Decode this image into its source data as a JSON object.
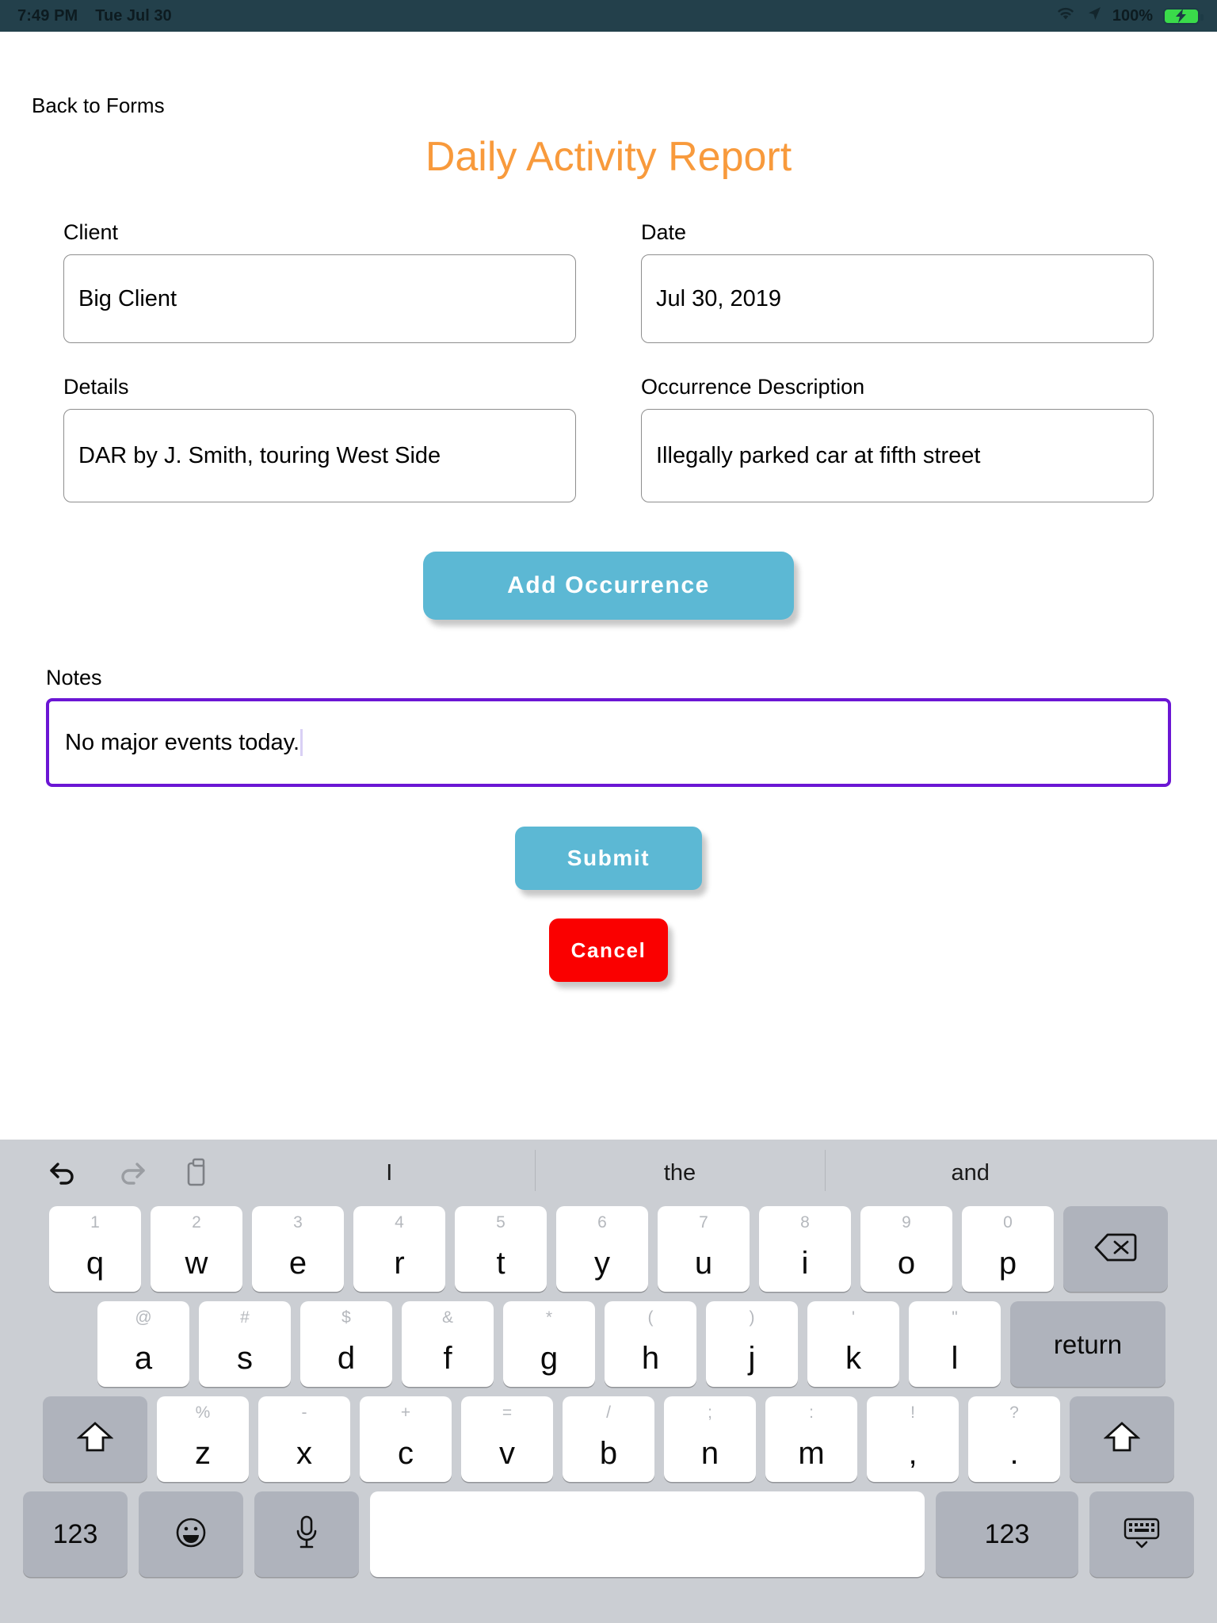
{
  "status_bar": {
    "time": "7:49 PM",
    "date": "Tue Jul 30",
    "battery_percent": "100%",
    "wifi_icon": "wifi-icon",
    "location_icon": "location-arrow-icon",
    "battery_icon": "battery-charging-icon",
    "background_color": "#23404B",
    "battery_fill_color": "#3ADB4A"
  },
  "nav": {
    "back_label": "Back to Forms"
  },
  "page": {
    "title": "Daily Activity Report",
    "title_color": "#F89A3C"
  },
  "form": {
    "fields": [
      {
        "label": "Client",
        "value": "Big Client"
      },
      {
        "label": "Date",
        "value": "Jul 30, 2019"
      },
      {
        "label": "Details",
        "value": "DAR by J. Smith, touring West Side"
      },
      {
        "label": "Occurrence Description",
        "value": "Illegally parked car at fifth street"
      }
    ],
    "notes": {
      "label": "Notes",
      "value": "No major events today.",
      "focus_border_color": "#6B16D4"
    }
  },
  "buttons": {
    "add_occurrence": {
      "label": "Add Occurrence",
      "color": "#5CB8D4"
    },
    "submit": {
      "label": "Submit",
      "color": "#5CB8D4"
    },
    "cancel": {
      "label": "Cancel",
      "color": "#FA0000"
    }
  },
  "keyboard": {
    "background_color": "#CBCED3",
    "toolbar": {
      "undo_icon": "undo-icon",
      "redo_icon": "redo-icon",
      "paste_icon": "paste-icon"
    },
    "suggestions": [
      "I",
      "the",
      "and"
    ],
    "row1": [
      {
        "main": "q",
        "sub": "1"
      },
      {
        "main": "w",
        "sub": "2"
      },
      {
        "main": "e",
        "sub": "3"
      },
      {
        "main": "r",
        "sub": "4"
      },
      {
        "main": "t",
        "sub": "5"
      },
      {
        "main": "y",
        "sub": "6"
      },
      {
        "main": "u",
        "sub": "7"
      },
      {
        "main": "i",
        "sub": "8"
      },
      {
        "main": "o",
        "sub": "9"
      },
      {
        "main": "p",
        "sub": "0"
      }
    ],
    "row2": [
      {
        "main": "a",
        "sub": "@"
      },
      {
        "main": "s",
        "sub": "#"
      },
      {
        "main": "d",
        "sub": "$"
      },
      {
        "main": "f",
        "sub": "&"
      },
      {
        "main": "g",
        "sub": "*"
      },
      {
        "main": "h",
        "sub": "("
      },
      {
        "main": "j",
        "sub": ")"
      },
      {
        "main": "k",
        "sub": "'"
      },
      {
        "main": "l",
        "sub": "\""
      }
    ],
    "row3": [
      {
        "main": "z",
        "sub": "%"
      },
      {
        "main": "x",
        "sub": "-"
      },
      {
        "main": "c",
        "sub": "+"
      },
      {
        "main": "v",
        "sub": "="
      },
      {
        "main": "b",
        "sub": "/"
      },
      {
        "main": "n",
        "sub": ";"
      },
      {
        "main": "m",
        "sub": ":"
      },
      {
        "main": ",",
        "sub": "!"
      },
      {
        "main": ".",
        "sub": "?"
      }
    ],
    "special": {
      "backspace_icon": "backspace-icon",
      "return_label": "return",
      "shift_left_icon": "shift-icon",
      "shift_right_icon": "shift-icon",
      "numbers_left_label": "123",
      "numbers_right_label": "123",
      "emoji_icon": "emoji-icon",
      "dictation_icon": "microphone-icon",
      "hide_keyboard_icon": "hide-keyboard-icon",
      "space_label": ""
    }
  }
}
